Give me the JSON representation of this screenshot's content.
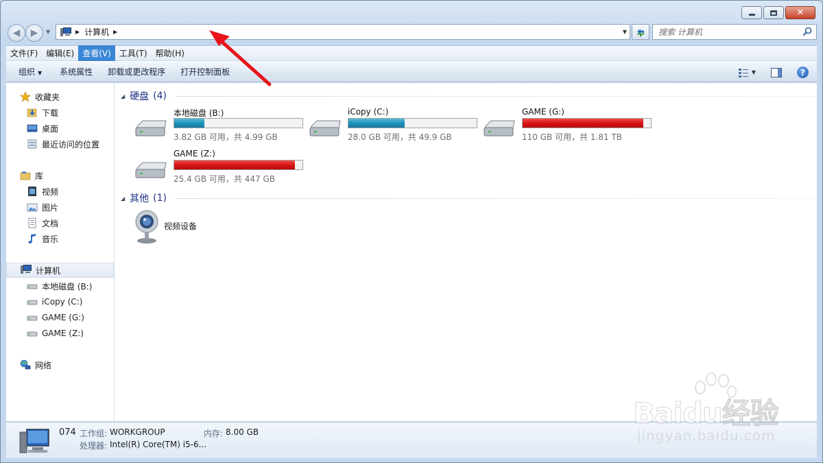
{
  "window": {
    "caption": {
      "minimize": "",
      "maximize": "",
      "close": "✕"
    }
  },
  "address": {
    "crumbs": [
      "计算机"
    ],
    "search_placeholder": "搜索 计算机"
  },
  "menu": {
    "items": [
      {
        "label": "文件(F)",
        "active": false
      },
      {
        "label": "编辑(E)",
        "active": false
      },
      {
        "label": "查看(V)",
        "active": true
      },
      {
        "label": "工具(T)",
        "active": false
      },
      {
        "label": "帮助(H)",
        "active": false
      }
    ]
  },
  "commands": {
    "organize": "组织",
    "system_properties": "系统属性",
    "uninstall": "卸载或更改程序",
    "control_panel": "打开控制面板"
  },
  "sidebar": {
    "favorites": {
      "label": "收藏夹",
      "items": [
        "下载",
        "桌面",
        "最近访问的位置"
      ]
    },
    "libraries": {
      "label": "库",
      "items": [
        "视频",
        "图片",
        "文档",
        "音乐"
      ]
    },
    "computer": {
      "label": "计算机",
      "items": [
        "本地磁盘 (B:)",
        "iCopy (C:)",
        "GAME (G:)",
        "GAME (Z:)"
      ]
    },
    "network": {
      "label": "网络"
    }
  },
  "groups": {
    "hard_drives": {
      "title": "硬盘",
      "count": "(4)"
    },
    "other": {
      "title": "其他",
      "count": "(1)"
    }
  },
  "drives": [
    {
      "name": "本地磁盘 (B:)",
      "free_text": "3.82 GB 可用，共 4.99 GB",
      "used_fraction": 0.234,
      "color": "blue"
    },
    {
      "name": "iCopy (C:)",
      "free_text": "28.0 GB 可用，共 49.9 GB",
      "used_fraction": 0.439,
      "color": "blue"
    },
    {
      "name": "GAME (G:)",
      "free_text": "110 GB 可用，共 1.81 TB",
      "used_fraction": 0.941,
      "color": "red"
    },
    {
      "name": "GAME (Z:)",
      "free_text": "25.4 GB 可用，共 447 GB",
      "used_fraction": 0.943,
      "color": "red"
    }
  ],
  "devices": [
    {
      "name": "视频设备"
    }
  ],
  "details": {
    "name": "074",
    "workgroup_label": "工作组:",
    "workgroup_value": "WORKGROUP",
    "memory_label": "内存:",
    "memory_value": "8.00 GB",
    "processor_label": "处理器:",
    "processor_value": "Intel(R) Core(TM) i5-6..."
  },
  "watermark": {
    "brand": "Baidu经验",
    "url": "jingyan.baidu.com"
  },
  "colors": {
    "accent": "#3a86d6",
    "drive_blue": "#1d8fb9",
    "drive_red": "#d61111",
    "group_title": "#1e3287",
    "arrow": "#e8141a"
  }
}
